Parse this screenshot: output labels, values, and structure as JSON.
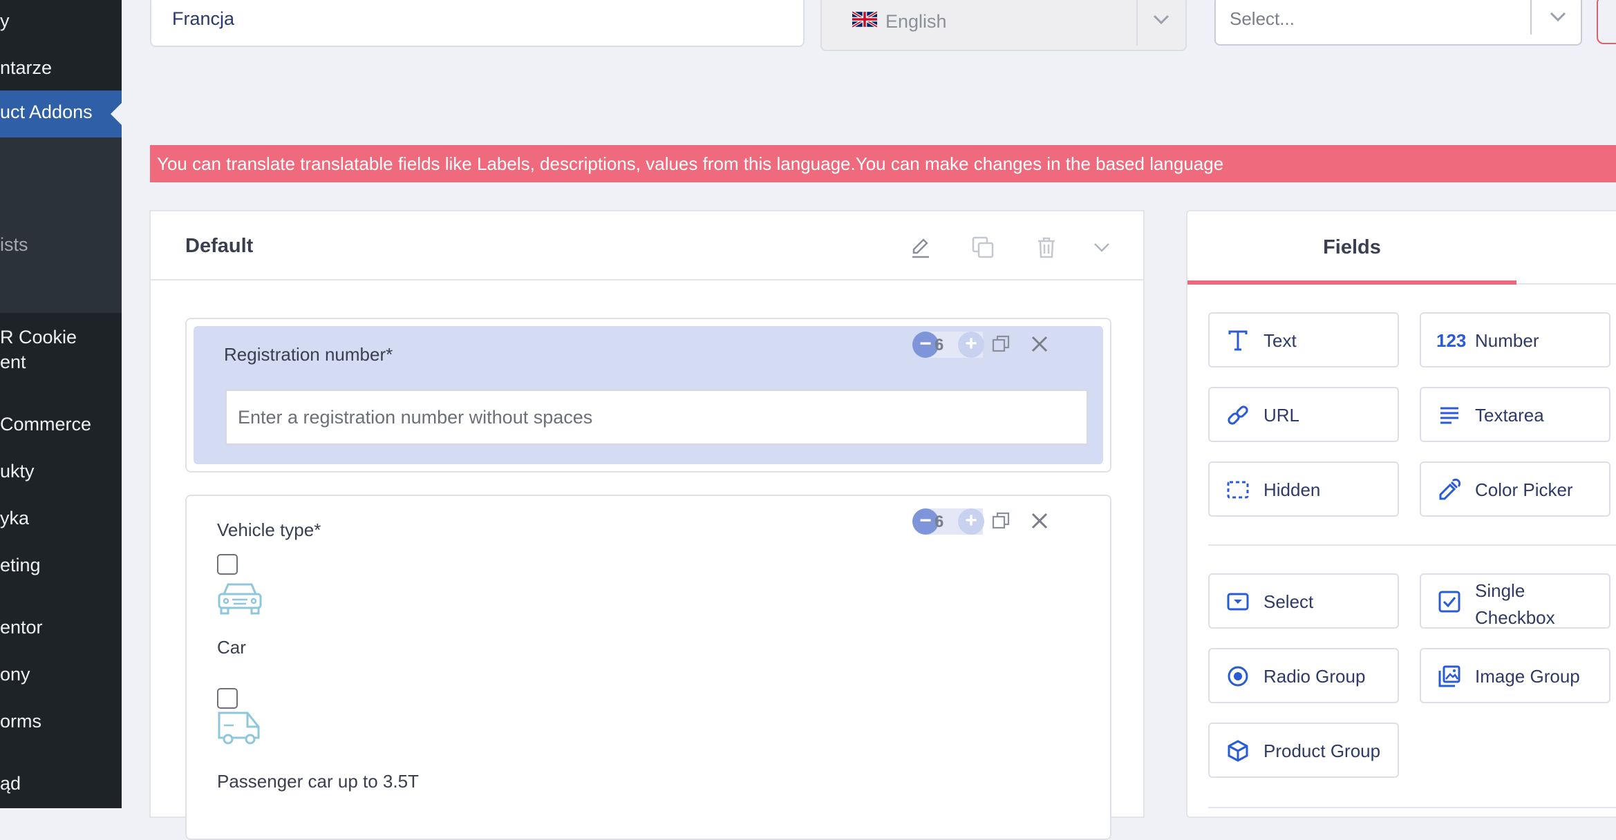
{
  "sidebar": {
    "items": [
      {
        "label": "y"
      },
      {
        "label": "ntarze"
      },
      {
        "label": "uct Addons"
      },
      {
        "label": "ists"
      },
      {
        "label": "R Cookie"
      },
      {
        "label": "ent"
      },
      {
        "label": "Commerce"
      },
      {
        "label": "ukty"
      },
      {
        "label": "yka"
      },
      {
        "label": "eting"
      },
      {
        "label": "entor"
      },
      {
        "label": "ony"
      },
      {
        "label": "orms"
      },
      {
        "label": "ąd"
      }
    ]
  },
  "top": {
    "name_value": "Francja",
    "language": "English",
    "select_placeholder": "Select..."
  },
  "banner": {
    "text": "You can translate translatable fields like Labels, descriptions, values from this language.You can make changes in the based language"
  },
  "group": {
    "title": "Default"
  },
  "fields": [
    {
      "label": "Registration number*",
      "placeholder": "Enter a registration number without spaces",
      "width": "6"
    },
    {
      "label": "Vehicle type*",
      "width": "6",
      "options": [
        {
          "label": "Car",
          "icon": "car-icon"
        },
        {
          "label": "Passenger car up to 3.5T",
          "icon": "van-icon"
        }
      ]
    }
  ],
  "fields_panel": {
    "tab": "Fields",
    "buttons": [
      {
        "label": "Text",
        "icon": "text-icon"
      },
      {
        "label": "Number",
        "icon": "number-icon",
        "icon_text": "123"
      },
      {
        "label": "URL",
        "icon": "link-icon"
      },
      {
        "label": "Textarea",
        "icon": "textarea-icon"
      },
      {
        "label": "Hidden",
        "icon": "hidden-icon"
      },
      {
        "label": "Color Picker",
        "icon": "eyedropper-icon"
      },
      {
        "label": "Select",
        "icon": "select-icon"
      },
      {
        "label": "Single Checkbox",
        "icon": "checkbox-icon"
      },
      {
        "label": "Radio Group",
        "icon": "radio-icon"
      },
      {
        "label": "Image Group",
        "icon": "image-group-icon"
      },
      {
        "label": "Product Group",
        "icon": "product-group-icon"
      }
    ]
  },
  "colors": {
    "sidebar_bg": "#1e2327",
    "sidebar_active": "#2f5fa6",
    "banner": "#ee6a7c",
    "accent_blue": "#2a5bd7",
    "selected_field_bg": "#d3dcf3"
  }
}
